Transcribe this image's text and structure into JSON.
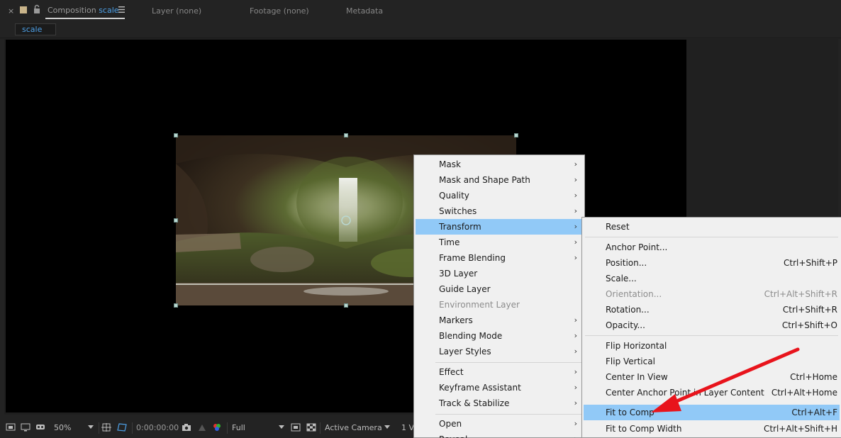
{
  "tabs": {
    "close_glyph": "×",
    "comp_prefix": "Composition",
    "comp_name": "scale",
    "layer": "Layer (none)",
    "footage": "Footage (none)",
    "metadata": "Metadata",
    "sub_tab": "scale"
  },
  "bottom_bar": {
    "zoom": "50%",
    "timecode": "0:00:00:00",
    "resolution": "Full",
    "camera": "Active Camera",
    "views": "1 V"
  },
  "main_menu": {
    "items": [
      {
        "label": "Mask",
        "sub": true
      },
      {
        "label": "Mask and Shape Path",
        "sub": true
      },
      {
        "label": "Quality",
        "sub": true
      },
      {
        "label": "Switches",
        "sub": true
      },
      {
        "label": "Transform",
        "sub": true,
        "highlight": true
      },
      {
        "label": "Time",
        "sub": true
      },
      {
        "label": "Frame Blending",
        "sub": true
      },
      {
        "label": "3D Layer"
      },
      {
        "label": "Guide Layer"
      },
      {
        "label": "Environment Layer",
        "disabled": true
      },
      {
        "label": "Markers",
        "sub": true
      },
      {
        "label": "Blending Mode",
        "sub": true
      },
      {
        "label": "Layer Styles",
        "sub": true
      },
      {
        "label": "Effect",
        "sub": true
      },
      {
        "label": "Keyframe Assistant",
        "sub": true
      },
      {
        "label": "Track & Stabilize",
        "sub": true
      },
      {
        "label": "Open",
        "sub": true
      },
      {
        "label": "Reveal",
        "sub": true
      }
    ]
  },
  "transform_menu": {
    "items": [
      {
        "label": "Reset",
        "shortcut": ""
      },
      {
        "label": "Anchor Point...",
        "shortcut": ""
      },
      {
        "label": "Position...",
        "shortcut": "Ctrl+Shift+P"
      },
      {
        "label": "Scale...",
        "shortcut": ""
      },
      {
        "label": "Orientation...",
        "shortcut": "Ctrl+Alt+Shift+R",
        "disabled": true
      },
      {
        "label": "Rotation...",
        "shortcut": "Ctrl+Shift+R"
      },
      {
        "label": "Opacity...",
        "shortcut": "Ctrl+Shift+O"
      },
      {
        "label": "Flip Horizontal",
        "shortcut": ""
      },
      {
        "label": "Flip Vertical",
        "shortcut": ""
      },
      {
        "label": "Center In View",
        "shortcut": "Ctrl+Home"
      },
      {
        "label": "Center Anchor Point in Layer Content",
        "shortcut": "Ctrl+Alt+Home"
      },
      {
        "label": "Fit to Comp",
        "shortcut": "Ctrl+Alt+F",
        "highlight": true
      },
      {
        "label": "Fit to Comp Width",
        "shortcut": "Ctrl+Alt+Shift+H"
      }
    ]
  },
  "submenu_arrow": "›",
  "colors": {
    "accent_blue": "#4ea1e8",
    "menu_highlight": "#91c9f7",
    "annotation_arrow": "#e8141c"
  }
}
